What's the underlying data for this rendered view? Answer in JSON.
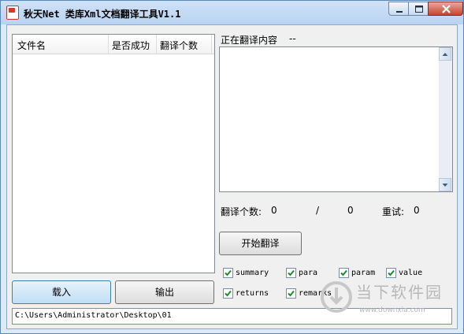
{
  "window": {
    "title": "秋天Net 类库Xml文档翻译工具V1.1"
  },
  "file_list": {
    "columns": [
      "文件名",
      "是否成功",
      "翻译个数"
    ],
    "rows": []
  },
  "status": {
    "label": "正在翻译内容",
    "value": "--"
  },
  "stats": {
    "count_label": "翻译个数:",
    "count_value": "0",
    "separator": "/",
    "total_value": "0",
    "retry_label": "重试:",
    "retry_value": "0"
  },
  "buttons": {
    "start": "开始翻译",
    "load": "载入",
    "export": "输出"
  },
  "options": [
    {
      "label": "summary",
      "checked": true
    },
    {
      "label": "para",
      "checked": true
    },
    {
      "label": "param",
      "checked": true
    },
    {
      "label": "value",
      "checked": true
    },
    {
      "label": "returns",
      "checked": true
    },
    {
      "label": "remarks",
      "checked": true
    }
  ],
  "path": "C:\\Users\\Administrator\\Desktop\\01",
  "watermark": {
    "name": "当下软件园",
    "url": "www.downxia.com"
  },
  "colors": {
    "window_frame": "#5a88b8",
    "close_button": "#c74430",
    "check": "#1f8a2f"
  }
}
